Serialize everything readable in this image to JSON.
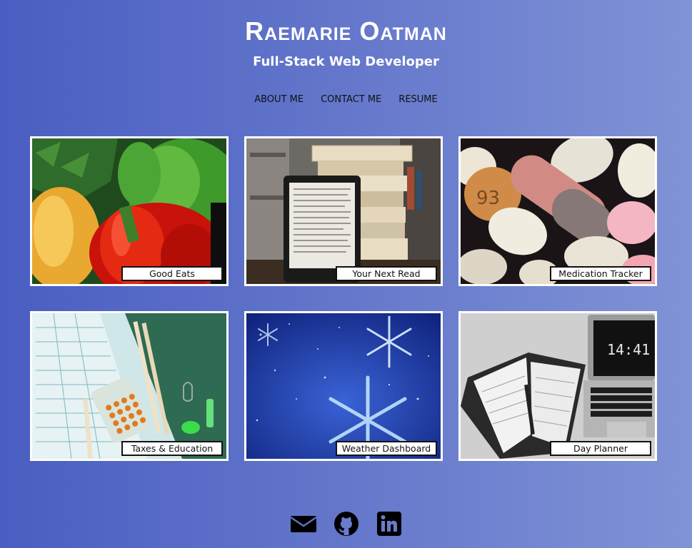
{
  "header": {
    "title": "Raemarie Oatman",
    "subtitle": "Full-Stack Web Developer"
  },
  "nav": {
    "items": [
      "ABOUT ME",
      "CONTACT ME",
      "RESUME"
    ]
  },
  "projects": [
    {
      "label": "Good Eats",
      "image": "bell-peppers-photo"
    },
    {
      "label": "Your Next Read",
      "image": "books-and-ereader-photo"
    },
    {
      "label": "Medication Tracker",
      "image": "pills-photo"
    },
    {
      "label": "Taxes & Education",
      "image": "tax-forms-calculator-photo"
    },
    {
      "label": "Weather Dashboard",
      "image": "snowflakes-photo"
    },
    {
      "label": "Day Planner",
      "image": "planner-laptop-photo"
    }
  ],
  "art": {
    "planner_clock": "14:41",
    "pill_left_number": "93"
  },
  "social": {
    "icons": [
      "email-icon",
      "github-icon",
      "linkedin-icon"
    ]
  },
  "colors": {
    "background_start": "#4a5ec2",
    "background_end": "#8093d6",
    "text": "#ffffff"
  }
}
